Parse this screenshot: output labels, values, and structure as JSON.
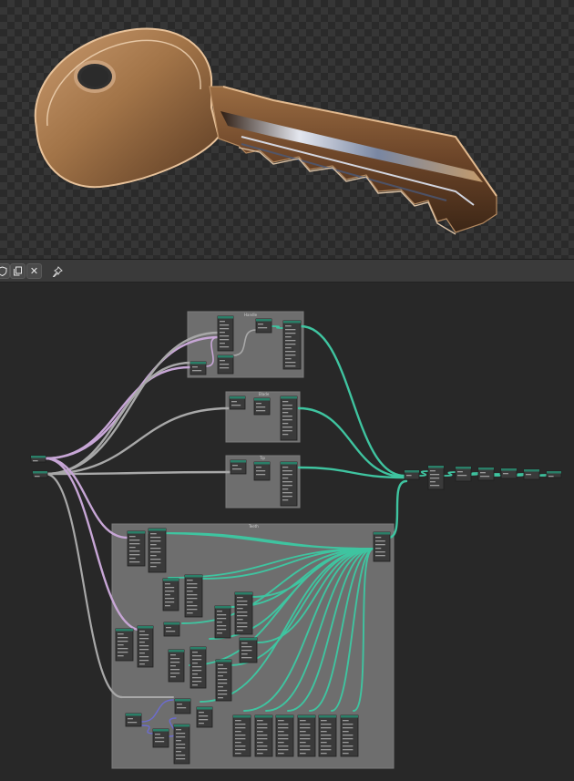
{
  "viewport": {
    "subject": "metal-key-render",
    "colors": {
      "metal": "#a27448",
      "highlight": "#f2d2b0",
      "shadow": "#3a2414",
      "bluesteel": "#c9d8ee"
    }
  },
  "toolbar": {
    "buttons": [
      {
        "name": "shield-icon",
        "interactable": true
      },
      {
        "name": "copy-icon",
        "interactable": true
      },
      {
        "name": "close-icon",
        "label": "✕",
        "interactable": true
      },
      {
        "name": "pin-icon",
        "interactable": true
      }
    ]
  },
  "node_graph": {
    "wire_colors": {
      "teal": "#3fc4a0",
      "gray": "#a8a8a8",
      "lavender": "#c7a6d6",
      "blue": "#6c6cd0"
    },
    "frame_titles": [
      "Handle",
      "Blade",
      "Tip",
      "Teeth"
    ]
  }
}
